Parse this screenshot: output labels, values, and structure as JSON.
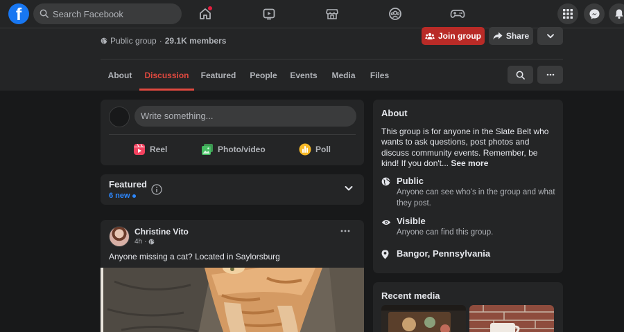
{
  "topbar": {
    "logo": "f",
    "search_placeholder": "Search Facebook",
    "icons": [
      "home-icon",
      "watch-icon",
      "marketplace-icon",
      "groups-icon",
      "gaming-icon",
      "menu-icon",
      "messenger-icon",
      "notifications-icon"
    ]
  },
  "group": {
    "privacy": "Public group",
    "separator": "·",
    "members": "29.1K members",
    "join_label": "Join group",
    "share_label": "Share"
  },
  "tabs": [
    "About",
    "Discussion",
    "Featured",
    "People",
    "Events",
    "Media",
    "Files"
  ],
  "active_tab": "Discussion",
  "composer": {
    "placeholder": "Write something...",
    "actions": [
      "Reel",
      "Photo/video",
      "Poll"
    ]
  },
  "featured": {
    "title": "Featured",
    "new_count": "6 new"
  },
  "post": {
    "author": "Christine Vito",
    "time": "4h",
    "dot": "·",
    "text": "Anyone missing a cat? Located in Saylorsburg"
  },
  "about": {
    "title": "About",
    "description": "This group is for anyone in the Slate Belt who wants to ask questions, post photos and discuss community events. Remember, be kind! If you don't...",
    "see_more": "See more",
    "public_title": "Public",
    "public_desc": "Anyone can see who's in the group and what they post.",
    "visible_title": "Visible",
    "visible_desc": "Anyone can find this group.",
    "location": "Bangor, Pennsylvania"
  },
  "recent_media": {
    "title": "Recent media"
  },
  "colors": {
    "accent": "#e0493f",
    "join_button": "#b92b27",
    "facebook_blue": "#1877f2",
    "link_blue": "#2d88ff",
    "background": "#18191a",
    "surface": "#242526"
  }
}
